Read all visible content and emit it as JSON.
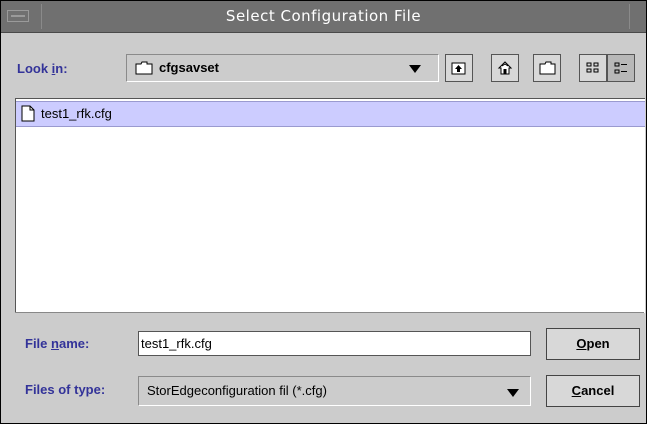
{
  "window": {
    "title": "Select Configuration File"
  },
  "lookin": {
    "label_pre": "Look ",
    "label_mn": "i",
    "label_post": "n:",
    "value": "cfgsavset"
  },
  "toolbar": {
    "up_icon": "up-one-level-icon",
    "home_icon": "home-icon",
    "new_folder_icon": "new-folder-icon",
    "list_icon": "list-view-icon",
    "details_icon": "details-view-icon"
  },
  "files": [
    {
      "name": "test1_rfk.cfg",
      "selected": true
    }
  ],
  "filename": {
    "label_pre": "File ",
    "label_mn": "n",
    "label_post": "ame:",
    "value": "test1_rfk.cfg"
  },
  "filetype": {
    "label": "Files of type:",
    "value": "StorEdgeconfiguration fil (*.cfg)"
  },
  "buttons": {
    "open_mn": "O",
    "open_rest": "pen",
    "cancel_mn": "C",
    "cancel_rest": "ancel"
  },
  "colors": {
    "label": "#333399",
    "selection": "#ccccff",
    "titlebar": "#707070"
  }
}
